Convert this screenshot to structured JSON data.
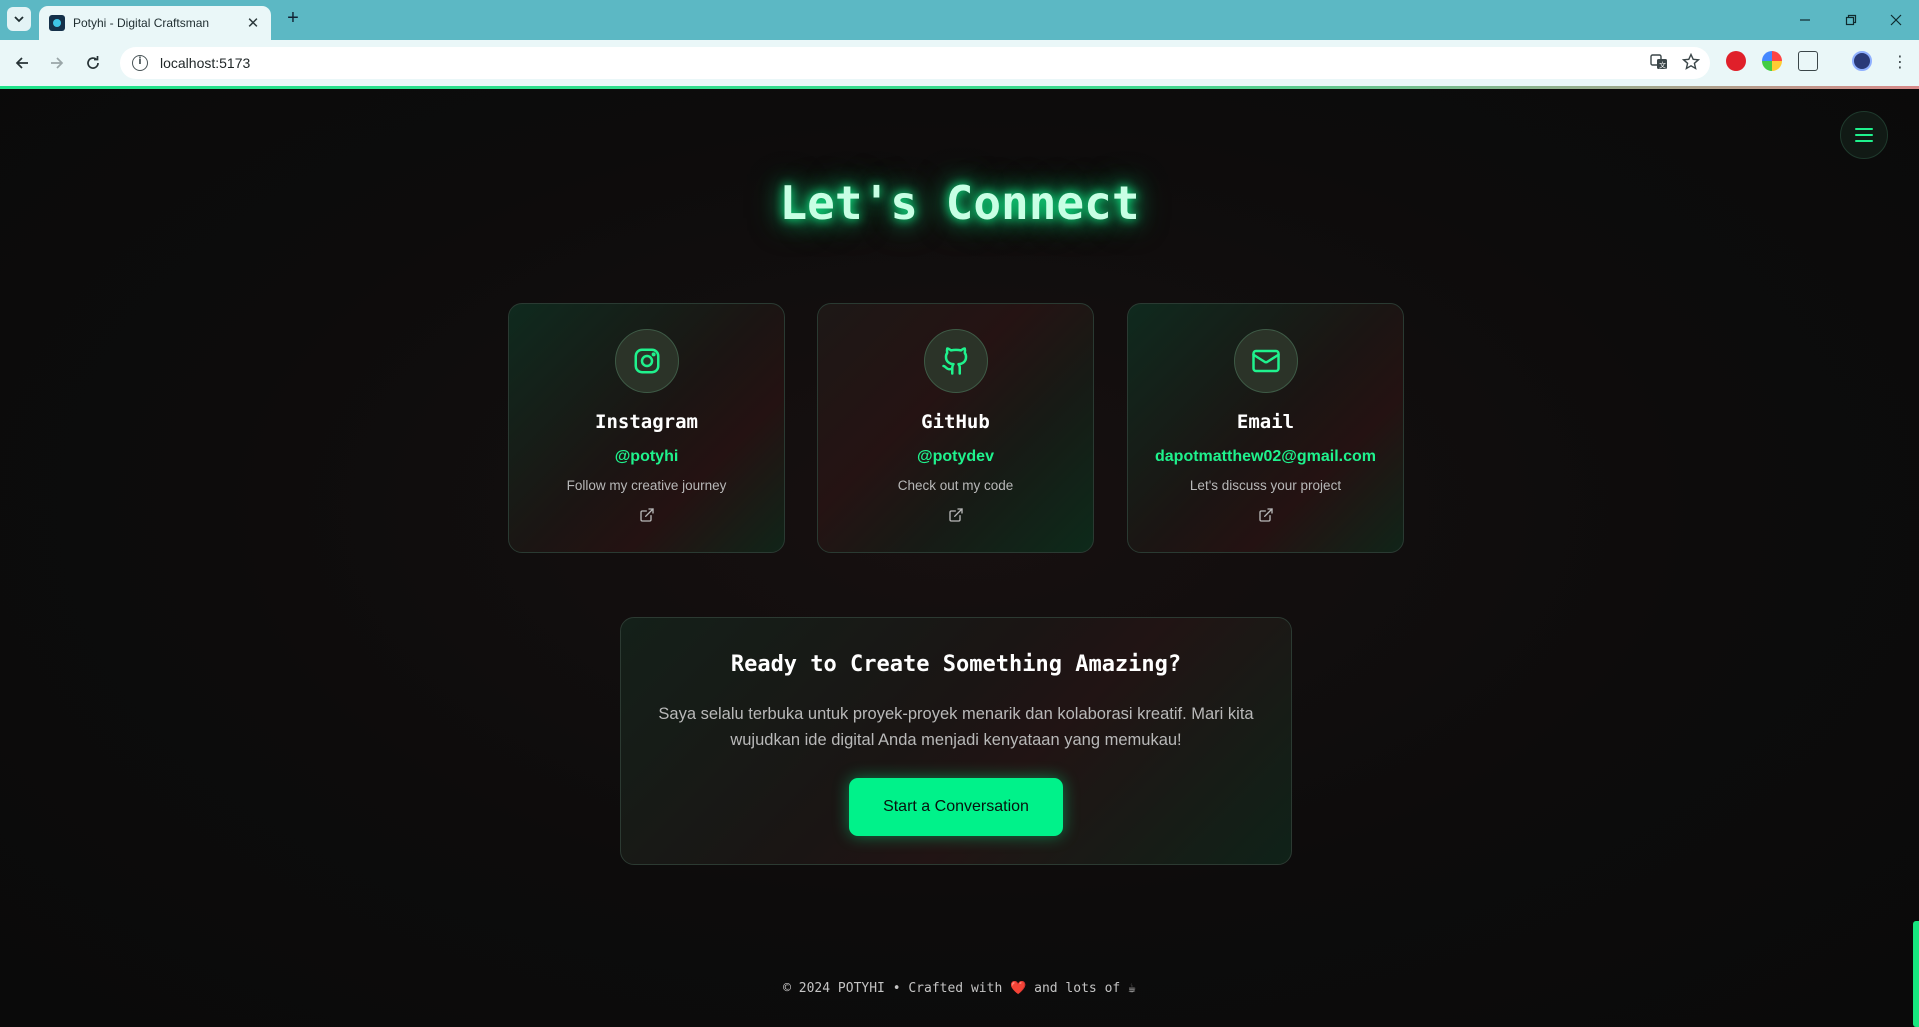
{
  "browser": {
    "tab_title": "Potyhi - Digital Craftsman",
    "url": "localhost:5173"
  },
  "page": {
    "heading": "Let's Connect",
    "cards": [
      {
        "title": "Instagram",
        "handle": "@potyhi",
        "description": "Follow my creative journey",
        "icon": "instagram-icon"
      },
      {
        "title": "GitHub",
        "handle": "@potydev",
        "description": "Check out my code",
        "icon": "github-icon"
      },
      {
        "title": "Email",
        "handle": "dapotmatthew02@gmail.com",
        "description": "Let's discuss your project",
        "icon": "mail-icon"
      }
    ],
    "cta": {
      "title": "Ready to Create Something Amazing?",
      "text": "Saya selalu terbuka untuk proyek-proyek menarik dan kolaborasi kreatif. Mari kita wujudkan ide digital Anda menjadi kenyataan yang memukau!",
      "button": "Start a Conversation"
    },
    "footer": {
      "prefix": "© 2024 POTYHI • Crafted with",
      "heart": "❤️",
      "middle": "and lots of",
      "coffee": "☕"
    }
  },
  "colors": {
    "accent": "#00f28a",
    "background": "#0c0c0c",
    "chrome": "#5cb8c4"
  }
}
